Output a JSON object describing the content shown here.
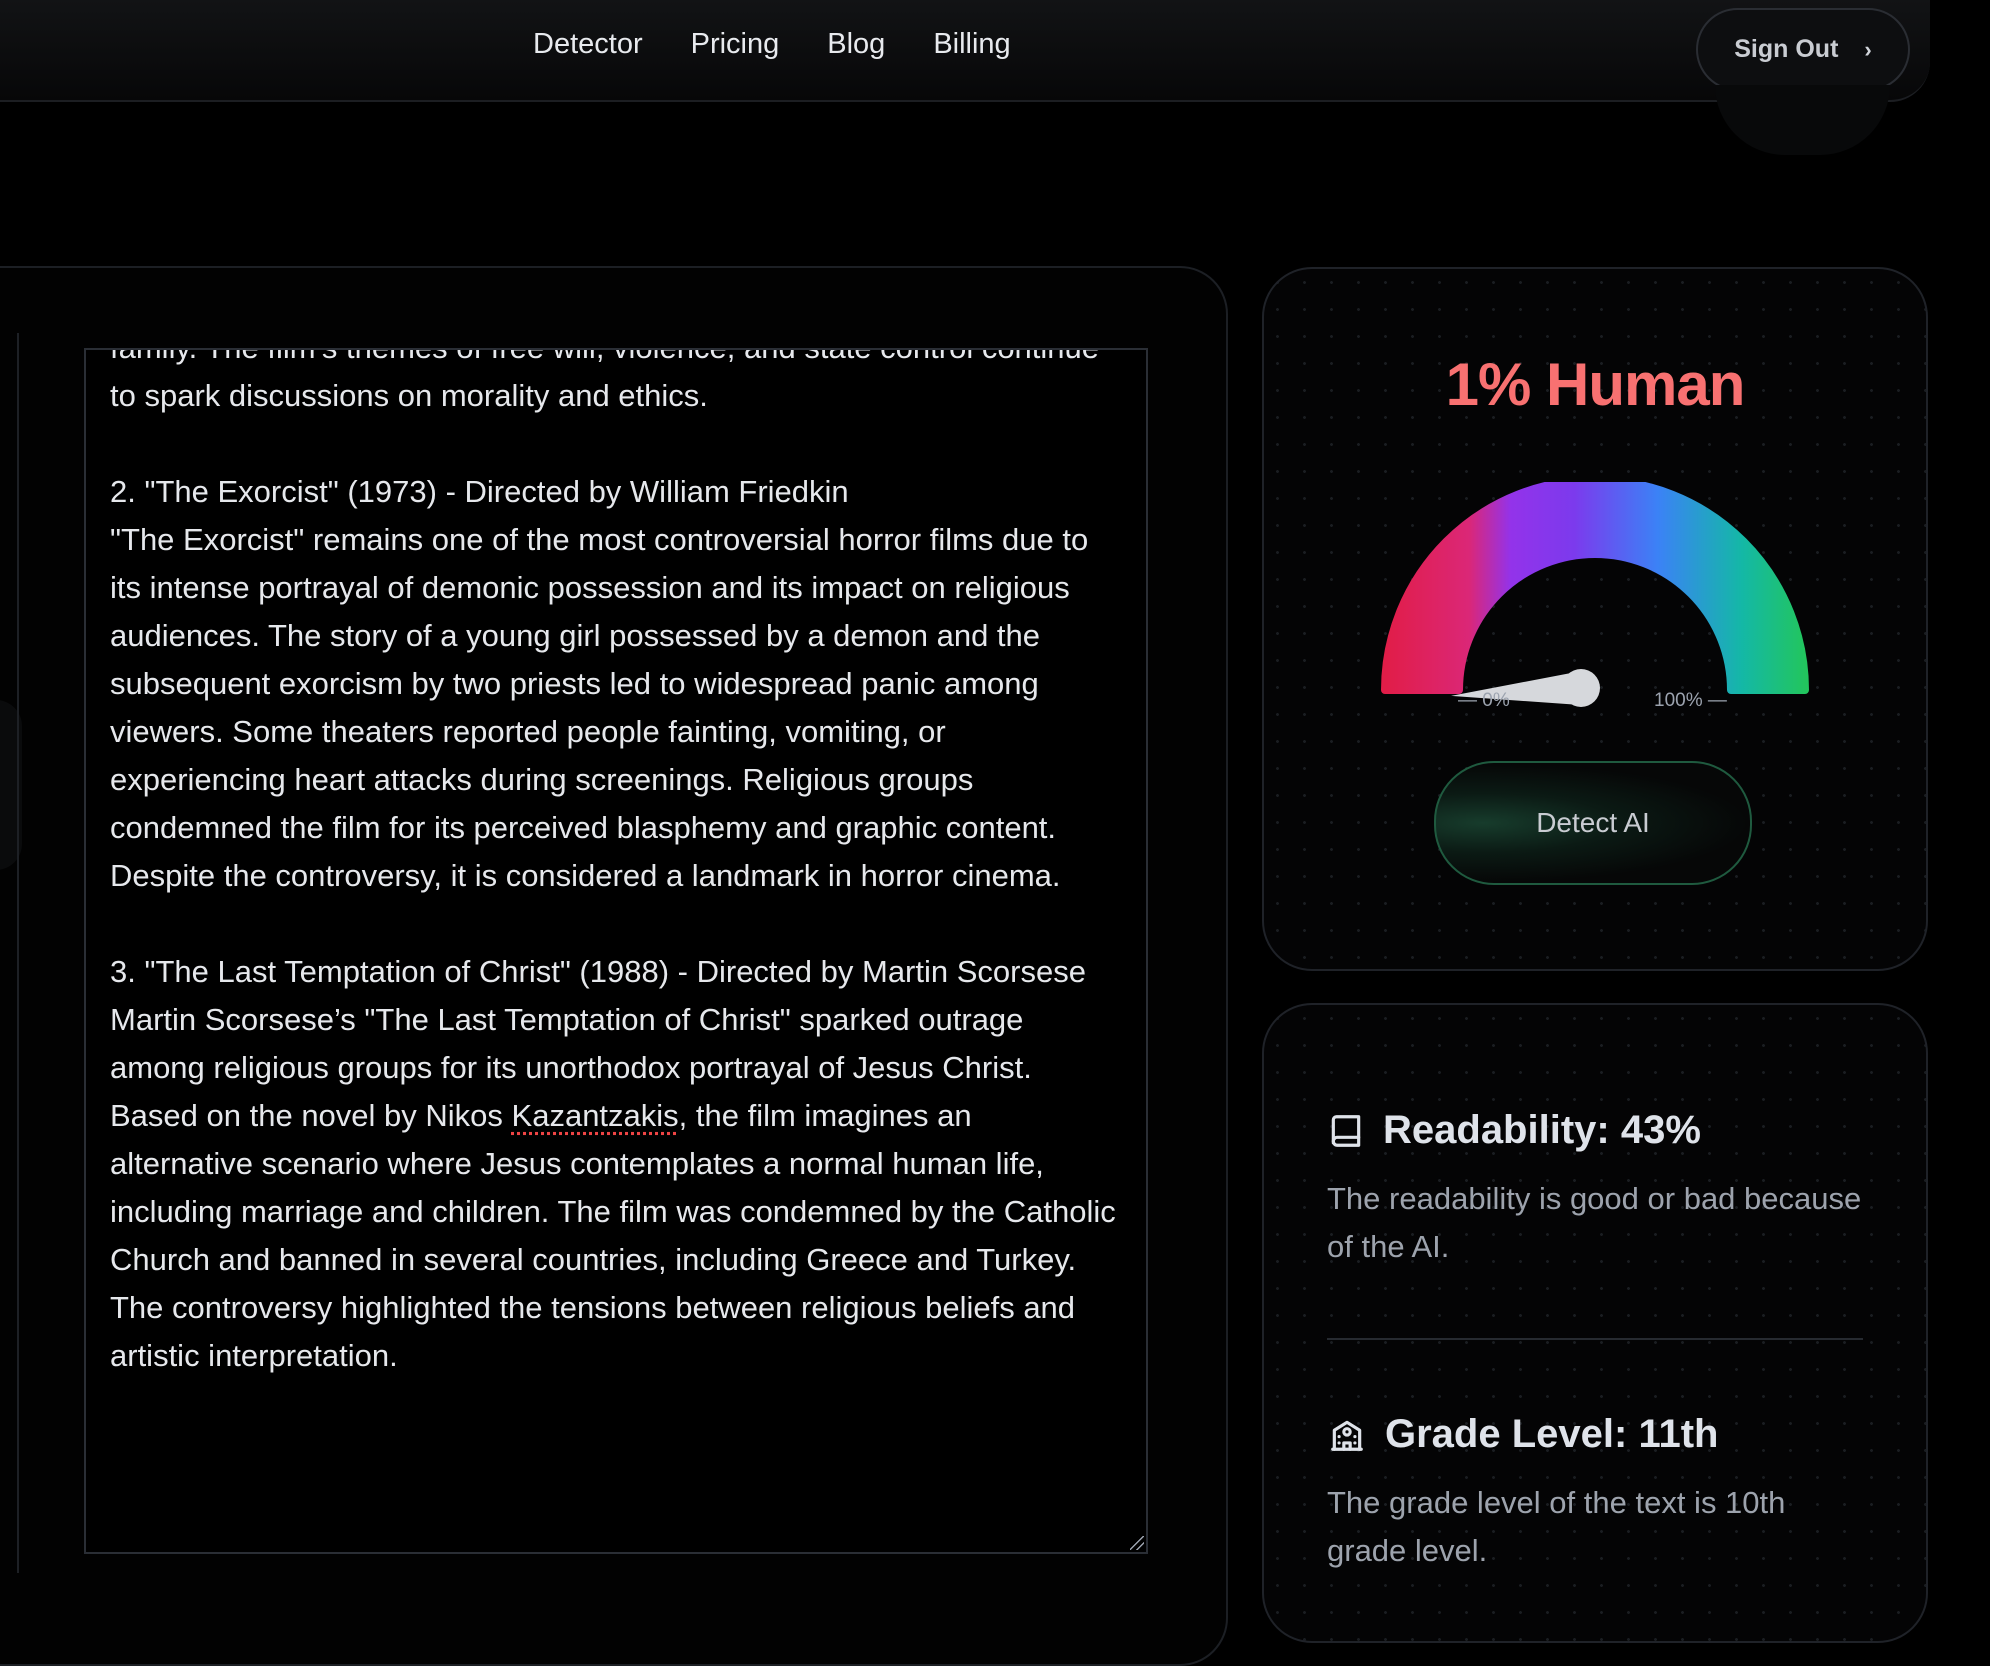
{
  "nav": {
    "links": [
      "Detector",
      "Pricing",
      "Blog",
      "Billing"
    ],
    "signout_label": "Sign Out",
    "signout_icon": "chevron-right-icon"
  },
  "editor": {
    "paragraphs": [
      "family. The film’s themes of free will, violence, and state control continue to spark discussions on morality and ethics.",
      "2. \"The Exorcist\" (1973) - Directed by William Friedkin\n\"The Exorcist\" remains one of the most controversial horror films due to its intense portrayal of demonic possession and its impact on religious audiences. The story of a young girl possessed by a demon and the subsequent exorcism by two priests led to widespread panic among viewers. Some theaters reported people fainting, vomiting, or experiencing heart attacks during screenings. Religious groups condemned the film for its perceived blasphemy and graphic content. Despite the controversy, it is considered a landmark in horror cinema.",
      "3. \"The Last Temptation of Christ\" (1988) - Directed by Martin Scorsese"
    ],
    "p4_before": "Martin Scorsese’s \"The Last Temptation of Christ\" sparked outrage among religious groups for its unorthodox portrayal of Jesus Christ. Based on the novel by Nikos ",
    "p4_misspelled": "Kazantzakis",
    "p4_after": ", the film imagines an alternative scenario where Jesus contemplates a normal human life, including marriage and children. The film was condemned by the Catholic Church and banned in several countries, including Greece and Turkey. The controversy highlighted the tensions between religious beliefs and artistic interpretation."
  },
  "score": {
    "title": "1% Human",
    "value_percent": 1,
    "gauge_min_label": "— 0%",
    "gauge_max_label": "100% —",
    "detect_label": "Detect AI",
    "colors": {
      "title": "#f87171",
      "gauge": [
        "#e11d48",
        "#9333ea",
        "#7c3aed",
        "#3b82f6",
        "#14b8a6",
        "#22c55e"
      ]
    }
  },
  "metrics": {
    "readability": {
      "title": "Readability: 43%",
      "desc": "The readability is good or bad because of the AI.",
      "icon": "book-icon"
    },
    "grade": {
      "title": "Grade Level: 11th",
      "desc": "The grade level of the text is 10th grade level.",
      "icon": "school-icon"
    }
  }
}
